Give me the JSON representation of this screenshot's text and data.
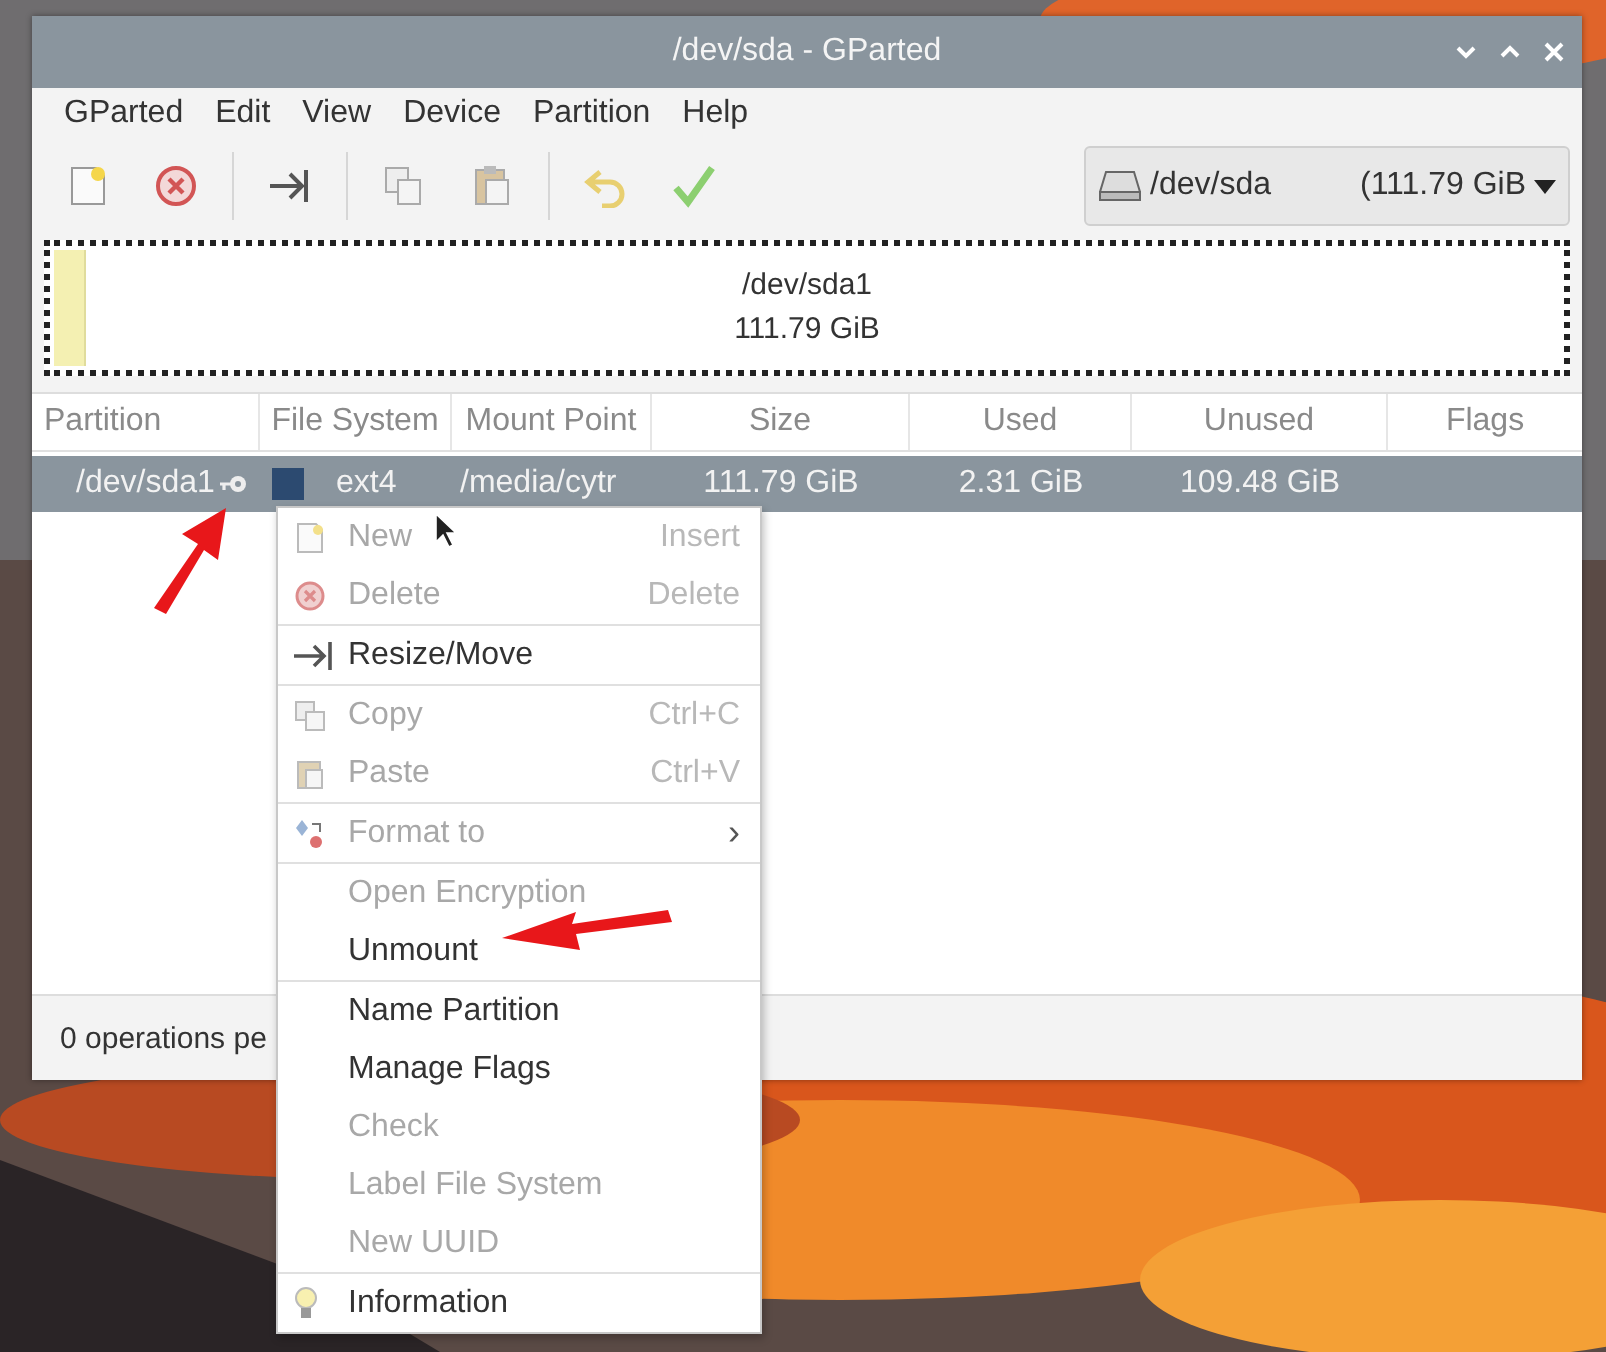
{
  "window": {
    "title": "/dev/sda - GParted"
  },
  "menubar": [
    "GParted",
    "Edit",
    "View",
    "Device",
    "Partition",
    "Help"
  ],
  "toolbar": [
    [
      {
        "kind": "new"
      },
      {
        "kind": "delete"
      }
    ],
    [
      {
        "kind": "resize"
      }
    ],
    [
      {
        "kind": "copy"
      },
      {
        "kind": "paste"
      }
    ],
    [
      {
        "kind": "undo"
      },
      {
        "kind": "apply"
      }
    ]
  ],
  "device_selector": {
    "device": "/dev/sda",
    "size": "(111.79 GiB"
  },
  "partition_map": {
    "name": "/dev/sda1",
    "size": "111.79 GiB",
    "level": 0.02
  },
  "table": {
    "columns": [
      "Partition",
      "File System",
      "Mount Point",
      "Size",
      "Used",
      "Unused",
      "Flags"
    ],
    "rows": [
      {
        "partition": "/dev/sda1",
        "color": "#2c4a70",
        "file_system": "ext4",
        "mount_point": "/media/cytr",
        "size": "111.79 GiB",
        "used": "2.31 GiB",
        "unused": "109.48 GiB",
        "selected": true
      }
    ]
  },
  "status_bar": "0 operations pe",
  "context_menu": [
    [
      {
        "kind": "new",
        "label": "New",
        "shortcut": "Insert",
        "disabled": true
      },
      {
        "kind": "delete",
        "label": "Delete",
        "shortcut": "Delete",
        "disabled": true
      }
    ],
    [
      {
        "kind": "resize",
        "label": "Resize/Move",
        "disabled": false
      }
    ],
    [
      {
        "kind": "copy",
        "label": "Copy",
        "shortcut": "Ctrl+C",
        "disabled": true
      },
      {
        "kind": "paste",
        "label": "Paste",
        "shortcut": "Ctrl+V",
        "disabled": true
      }
    ],
    [
      {
        "kind": "format",
        "label": "Format to",
        "disabled": true,
        "submenu": "›"
      }
    ],
    [
      {
        "kind": "plain",
        "label": "Open Encryption",
        "disabled": true
      },
      {
        "kind": "plain",
        "label": "Unmount",
        "disabled": false
      }
    ],
    [
      {
        "kind": "plain",
        "label": "Name Partition",
        "disabled": false
      },
      {
        "kind": "plain",
        "label": "Manage Flags",
        "disabled": false
      },
      {
        "kind": "plain",
        "label": "Check",
        "disabled": true
      },
      {
        "kind": "plain",
        "label": "Label File System",
        "disabled": true
      },
      {
        "kind": "plain",
        "label": "New UUID",
        "disabled": true
      }
    ],
    [
      {
        "kind": "info",
        "label": "Information",
        "disabled": false
      }
    ]
  ]
}
